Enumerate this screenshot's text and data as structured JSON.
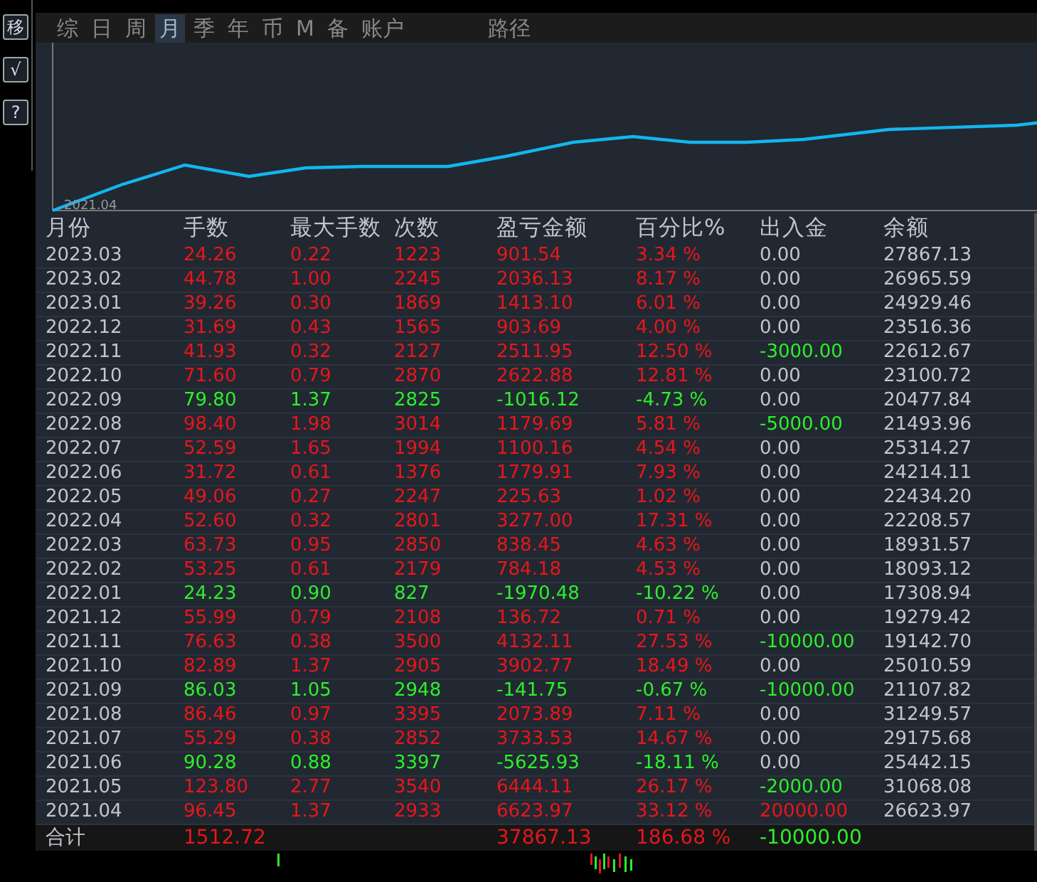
{
  "side_buttons": [
    "移",
    "√",
    "?"
  ],
  "tabs": [
    {
      "label": "综",
      "selected": false
    },
    {
      "label": "日",
      "selected": false
    },
    {
      "label": "周",
      "selected": false
    },
    {
      "label": "月",
      "selected": true
    },
    {
      "label": "季",
      "selected": false
    },
    {
      "label": "年",
      "selected": false
    },
    {
      "label": "币",
      "selected": false
    },
    {
      "label": "M",
      "selected": false
    },
    {
      "label": "备",
      "selected": false
    },
    {
      "label": "账户",
      "selected": false
    }
  ],
  "path_tab": {
    "label": "路径",
    "selected": false
  },
  "chart": {
    "x_label": "2021.04"
  },
  "table": {
    "columns": [
      "月份",
      "手数",
      "最大手数",
      "次数",
      "盈亏金额",
      "百分比%",
      "出入金",
      "余额"
    ],
    "rows": [
      {
        "month": "2023.03",
        "lots": "24.26",
        "max_lots": "0.22",
        "count": "1223",
        "pnl": "901.54",
        "pct": "3.34 %",
        "inflow": {
          "text": "0.00",
          "color": "#c2c6cc"
        },
        "balance": "27867.13",
        "loss": false
      },
      {
        "month": "2023.02",
        "lots": "44.78",
        "max_lots": "1.00",
        "count": "2245",
        "pnl": "2036.13",
        "pct": "8.17 %",
        "inflow": {
          "text": "0.00",
          "color": "#c2c6cc"
        },
        "balance": "26965.59",
        "loss": false
      },
      {
        "month": "2023.01",
        "lots": "39.26",
        "max_lots": "0.30",
        "count": "1869",
        "pnl": "1413.10",
        "pct": "6.01 %",
        "inflow": {
          "text": "0.00",
          "color": "#c2c6cc"
        },
        "balance": "24929.46",
        "loss": false
      },
      {
        "month": "2022.12",
        "lots": "31.69",
        "max_lots": "0.43",
        "count": "1565",
        "pnl": "903.69",
        "pct": "4.00 %",
        "inflow": {
          "text": "0.00",
          "color": "#c2c6cc"
        },
        "balance": "23516.36",
        "loss": false
      },
      {
        "month": "2022.11",
        "lots": "41.93",
        "max_lots": "0.32",
        "count": "2127",
        "pnl": "2511.95",
        "pct": "12.50 %",
        "inflow": {
          "text": "-3000.00",
          "color": "#2bf02b"
        },
        "balance": "22612.67",
        "loss": false
      },
      {
        "month": "2022.10",
        "lots": "71.60",
        "max_lots": "0.79",
        "count": "2870",
        "pnl": "2622.88",
        "pct": "12.81 %",
        "inflow": {
          "text": "0.00",
          "color": "#c2c6cc"
        },
        "balance": "23100.72",
        "loss": false
      },
      {
        "month": "2022.09",
        "lots": "79.80",
        "max_lots": "1.37",
        "count": "2825",
        "pnl": "-1016.12",
        "pct": "-4.73 %",
        "inflow": {
          "text": "0.00",
          "color": "#c2c6cc"
        },
        "balance": "20477.84",
        "loss": true
      },
      {
        "month": "2022.08",
        "lots": "98.40",
        "max_lots": "1.98",
        "count": "3014",
        "pnl": "1179.69",
        "pct": "5.81 %",
        "inflow": {
          "text": "-5000.00",
          "color": "#2bf02b"
        },
        "balance": "21493.96",
        "loss": false
      },
      {
        "month": "2022.07",
        "lots": "52.59",
        "max_lots": "1.65",
        "count": "1994",
        "pnl": "1100.16",
        "pct": "4.54 %",
        "inflow": {
          "text": "0.00",
          "color": "#c2c6cc"
        },
        "balance": "25314.27",
        "loss": false
      },
      {
        "month": "2022.06",
        "lots": "31.72",
        "max_lots": "0.61",
        "count": "1376",
        "pnl": "1779.91",
        "pct": "7.93 %",
        "inflow": {
          "text": "0.00",
          "color": "#c2c6cc"
        },
        "balance": "24214.11",
        "loss": false
      },
      {
        "month": "2022.05",
        "lots": "49.06",
        "max_lots": "0.27",
        "count": "2247",
        "pnl": "225.63",
        "pct": "1.02 %",
        "inflow": {
          "text": "0.00",
          "color": "#c2c6cc"
        },
        "balance": "22434.20",
        "loss": false
      },
      {
        "month": "2022.04",
        "lots": "52.60",
        "max_lots": "0.32",
        "count": "2801",
        "pnl": "3277.00",
        "pct": "17.31 %",
        "inflow": {
          "text": "0.00",
          "color": "#c2c6cc"
        },
        "balance": "22208.57",
        "loss": false
      },
      {
        "month": "2022.03",
        "lots": "63.73",
        "max_lots": "0.95",
        "count": "2850",
        "pnl": "838.45",
        "pct": "4.63 %",
        "inflow": {
          "text": "0.00",
          "color": "#c2c6cc"
        },
        "balance": "18931.57",
        "loss": false
      },
      {
        "month": "2022.02",
        "lots": "53.25",
        "max_lots": "0.61",
        "count": "2179",
        "pnl": "784.18",
        "pct": "4.53 %",
        "inflow": {
          "text": "0.00",
          "color": "#c2c6cc"
        },
        "balance": "18093.12",
        "loss": false
      },
      {
        "month": "2022.01",
        "lots": "24.23",
        "max_lots": "0.90",
        "count": "827",
        "pnl": "-1970.48",
        "pct": "-10.22 %",
        "inflow": {
          "text": "0.00",
          "color": "#c2c6cc"
        },
        "balance": "17308.94",
        "loss": true
      },
      {
        "month": "2021.12",
        "lots": "55.99",
        "max_lots": "0.79",
        "count": "2108",
        "pnl": "136.72",
        "pct": "0.71 %",
        "inflow": {
          "text": "0.00",
          "color": "#c2c6cc"
        },
        "balance": "19279.42",
        "loss": false
      },
      {
        "month": "2021.11",
        "lots": "76.63",
        "max_lots": "0.38",
        "count": "3500",
        "pnl": "4132.11",
        "pct": "27.53 %",
        "inflow": {
          "text": "-10000.00",
          "color": "#2bf02b"
        },
        "balance": "19142.70",
        "loss": false
      },
      {
        "month": "2021.10",
        "lots": "82.89",
        "max_lots": "1.37",
        "count": "2905",
        "pnl": "3902.77",
        "pct": "18.49 %",
        "inflow": {
          "text": "0.00",
          "color": "#c2c6cc"
        },
        "balance": "25010.59",
        "loss": false
      },
      {
        "month": "2021.09",
        "lots": "86.03",
        "max_lots": "1.05",
        "count": "2948",
        "pnl": "-141.75",
        "pct": "-0.67 %",
        "inflow": {
          "text": "-10000.00",
          "color": "#2bf02b"
        },
        "balance": "21107.82",
        "loss": true
      },
      {
        "month": "2021.08",
        "lots": "86.46",
        "max_lots": "0.97",
        "count": "3395",
        "pnl": "2073.89",
        "pct": "7.11 %",
        "inflow": {
          "text": "0.00",
          "color": "#c2c6cc"
        },
        "balance": "31249.57",
        "loss": false
      },
      {
        "month": "2021.07",
        "lots": "55.29",
        "max_lots": "0.38",
        "count": "2852",
        "pnl": "3733.53",
        "pct": "14.67 %",
        "inflow": {
          "text": "0.00",
          "color": "#c2c6cc"
        },
        "balance": "29175.68",
        "loss": false
      },
      {
        "month": "2021.06",
        "lots": "90.28",
        "max_lots": "0.88",
        "count": "3397",
        "pnl": "-5625.93",
        "pct": "-18.11 %",
        "inflow": {
          "text": "0.00",
          "color": "#c2c6cc"
        },
        "balance": "25442.15",
        "loss": true
      },
      {
        "month": "2021.05",
        "lots": "123.80",
        "max_lots": "2.77",
        "count": "3540",
        "pnl": "6444.11",
        "pct": "26.17 %",
        "inflow": {
          "text": "-2000.00",
          "color": "#2bf02b"
        },
        "balance": "31068.08",
        "loss": false
      },
      {
        "month": "2021.04",
        "lots": "96.45",
        "max_lots": "1.37",
        "count": "2933",
        "pnl": "6623.97",
        "pct": "33.12 %",
        "inflow": {
          "text": "20000.00",
          "color": "#e8161b"
        },
        "balance": "26623.97",
        "loss": false
      }
    ],
    "total": {
      "label": "合计",
      "lots": "1512.72",
      "pnl": "37867.13",
      "pct": "186.68 %",
      "inflow": {
        "text": "-10000.00",
        "color": "#2bf02b"
      }
    }
  }
}
